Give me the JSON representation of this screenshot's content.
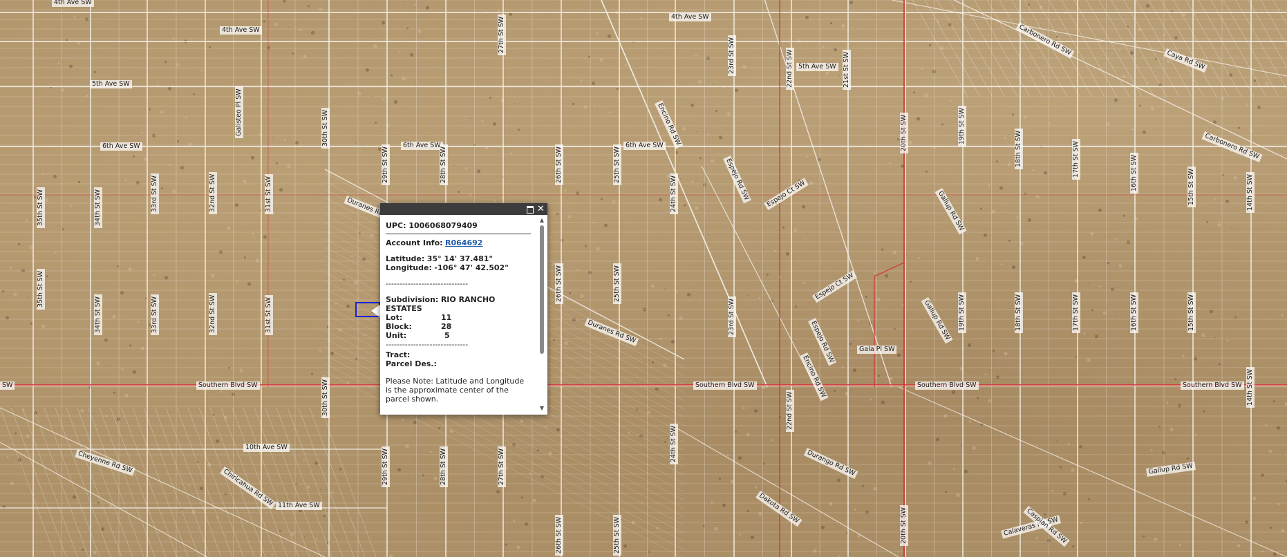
{
  "streets": {
    "ave_4_top_left": "4th Ave SW",
    "ave_4_top_mid": "4th Ave SW",
    "ave_4_right": "4th Ave SW",
    "ave_5_left": "5th Ave SW",
    "ave_5_right": "5th Ave SW",
    "ave_6_left": "6th Ave SW",
    "ave_6_mid": "6th Ave SW",
    "ave_6_right": "6th Ave SW",
    "ave_10": "10th Ave SW",
    "ave_11": "11th Ave SW",
    "southern_left": "Southern Blvd SW",
    "southern_mid": "Southern Blvd SW",
    "southern_right": "Southern Blvd SW",
    "southern_far": "Southern Blvd SW",
    "southern_edge": "SW",
    "st_35": "35th St SW",
    "st_34": "34th St SW",
    "st_33": "33rd St SW",
    "st_32": "32nd St SW",
    "st_31": "31st St SW",
    "st_30": "30th St SW",
    "st_29": "29th St SW",
    "st_28": "28th St SW",
    "st_27": "27th St SW",
    "st_26": "26th St SW",
    "st_25": "25th St SW",
    "st_24": "24th St SW",
    "st_23": "23rd St SW",
    "st_22": "22nd St SW",
    "st_21": "21st St SW",
    "st_20": "20th St SW",
    "st_19": "19th St SW",
    "st_18": "18th St SW",
    "st_17": "17th St SW",
    "st_16": "16th St SW",
    "st_15": "15th St SW",
    "st_14": "14th St SW",
    "galisteo": "Galisteo Pl SW",
    "duranes": "Duranes Rd SW",
    "encino": "Encino Rd SW",
    "encino_lower": "Encino Rd SW",
    "espejo": "Espejo Rd SW",
    "espejo_ct": "Espejo Ct SW",
    "gallup": "Gallup Rd SW",
    "gallup_lower": "Gallup Rd SW",
    "gala": "Gala Pl SW",
    "durango": "Durango Rd SW",
    "dakota": "Dakota Rd SW",
    "caya": "Caya Rd SW",
    "carbonero": "Carbonero Rd SW",
    "cheyenne": "Cheyenne Rd SW",
    "chiricahua": "Chiricahua Rd SW",
    "calaveras": "Calaveras Rd SW",
    "caspian": "Caspian Rd SW"
  },
  "popup": {
    "upc_label": "UPC:",
    "upc_value": "1006068079409",
    "account_label": "Account Info:",
    "account_link": "R064692",
    "latitude_label": "Latitude:",
    "latitude_value": "35° 14' 37.481\"",
    "longitude_label": "Longitude:",
    "longitude_value": "-106° 47' 42.502\"",
    "divider": "------------------------------",
    "subdivision_label": "Subdivision:",
    "subdivision_value": "RIO RANCHO ESTATES",
    "lot_label": "Lot:",
    "lot_value": "11",
    "block_label": "Block:",
    "block_value": "28",
    "unit_label": "Unit:",
    "unit_value": "5",
    "tract_label": "Tract:",
    "parcel_label": "Parcel Des.:",
    "note": "Please Note: Latitude and Longitude is the approximate center of the parcel shown."
  },
  "colors": {
    "titlebar": "#3c3c3c",
    "highlight": "#1a24d6",
    "boundary": "#d6262a",
    "link": "#1e5aa8"
  }
}
